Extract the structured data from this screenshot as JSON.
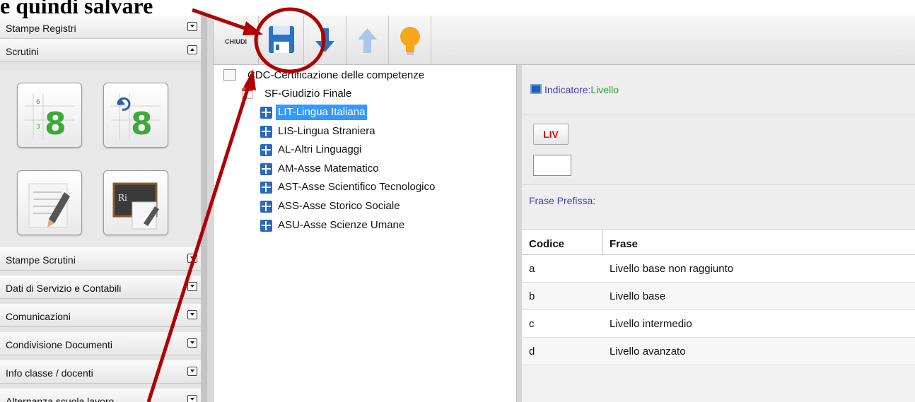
{
  "annotation": {
    "text": "e quindi salvare"
  },
  "sidebar": {
    "sections": [
      {
        "label": "Stampe Registri",
        "collapsed": true
      },
      {
        "label": "Scrutini",
        "collapsed": false
      },
      {
        "label": "Stampe Scrutini",
        "collapsed": true
      },
      {
        "label": "Dati di Servizio e Contabili",
        "collapsed": true
      },
      {
        "label": "Comunicazioni",
        "collapsed": true
      },
      {
        "label": "Condivisione Documenti",
        "collapsed": true
      },
      {
        "label": "Info classe / docenti",
        "collapsed": true
      },
      {
        "label": "Alternanza scuola lavoro",
        "collapsed": true
      }
    ]
  },
  "toolbar": {
    "close_label": "CHIUDI",
    "buttons": [
      "save-icon",
      "arrow-down-icon",
      "arrow-up-icon",
      "lightbulb-icon"
    ]
  },
  "tree": {
    "root": "CDC-Certificazione delle competenze",
    "child": "SF-Giudizio Finale",
    "items": [
      "LIT-Lingua Italiana",
      "LIS-Lingua Straniera",
      "AL-Altri Linguaggi",
      "AM-Asse Matematico",
      "AST-Asse Scientifico Tecnologico",
      "ASS-Asse Storico Sociale",
      "ASU-Asse Scienze Umane"
    ],
    "selected": "LIT-Lingua Italiana"
  },
  "detail": {
    "indicatore_label": "Indicatore:",
    "indicatore_value": "Livello",
    "liv_button": "LIV",
    "frase_prefissa_label": "Frase Prefissa:",
    "table": {
      "headers": [
        "Codice",
        "Frase"
      ],
      "rows": [
        [
          "a",
          "Livello base non raggiunto"
        ],
        [
          "b",
          "Livello base"
        ],
        [
          "c",
          "Livello intermedio"
        ],
        [
          "d",
          "Livello avanzato"
        ]
      ]
    }
  },
  "colors": {
    "annotation_red": "#b00000",
    "selection_blue": "#3399ff",
    "node_blue": "#2a6ab8",
    "indicator_green": "#2e9a2e"
  }
}
